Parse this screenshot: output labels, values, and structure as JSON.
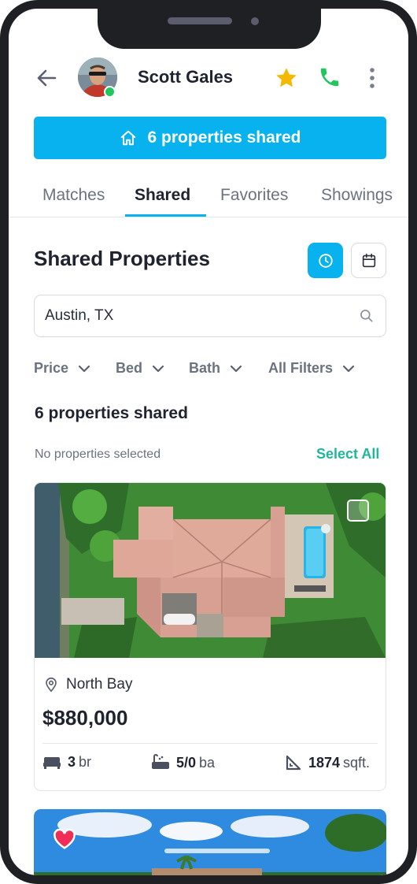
{
  "header": {
    "contact_name": "Scott Gales",
    "online": true
  },
  "banner": {
    "label": "6 properties shared"
  },
  "tabs": [
    {
      "label": "Matches",
      "active": false
    },
    {
      "label": "Shared",
      "active": true
    },
    {
      "label": "Favorites",
      "active": false
    },
    {
      "label": "Showings",
      "active": false
    }
  ],
  "section": {
    "title": "Shared Properties"
  },
  "search": {
    "value": "Austin, TX"
  },
  "filters": [
    {
      "label": "Price"
    },
    {
      "label": "Bed"
    },
    {
      "label": "Bath"
    },
    {
      "label": "All Filters"
    }
  ],
  "results": {
    "count_label": "6 properties shared",
    "selection_status": "No properties selected",
    "select_all_label": "Select All"
  },
  "listings": [
    {
      "location": "North Bay",
      "price": "$880,000",
      "beds_value": "3",
      "beds_unit": "br",
      "baths_value": "5/0",
      "baths_unit": "ba",
      "area_value": "1874",
      "area_unit": "sqft.",
      "selected": false
    }
  ],
  "colors": {
    "accent": "#08b2ee",
    "select_all": "#1fb79a",
    "star": "#f5b800",
    "phone": "#22c55e",
    "heart": "#ef2d56",
    "online": "#22c55e"
  },
  "icons": [
    "back-arrow-icon",
    "star-icon",
    "phone-icon",
    "more-vertical-icon",
    "home-icon",
    "clock-icon",
    "calendar-icon",
    "search-icon",
    "chevron-down-icon",
    "map-pin-icon",
    "bed-icon",
    "bath-icon",
    "ruler-icon",
    "heart-icon"
  ]
}
